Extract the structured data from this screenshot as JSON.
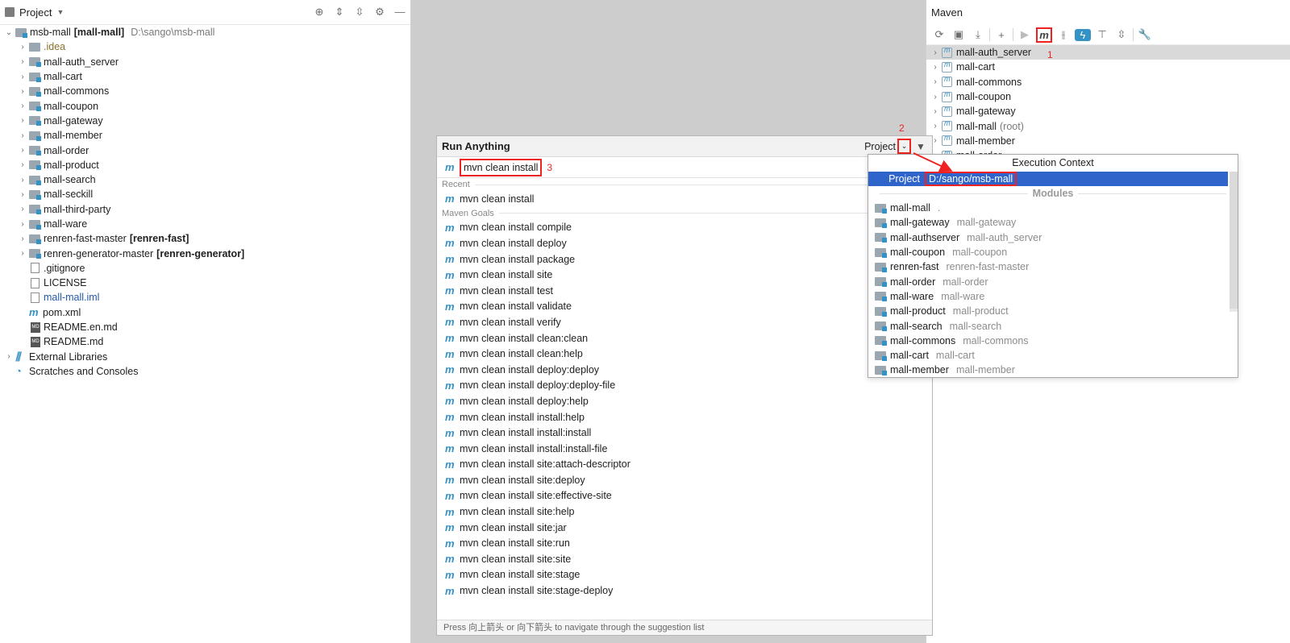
{
  "project": {
    "title": "Project",
    "tree": [
      {
        "label": "msb-mall",
        "bold": "[mall-mall]",
        "path": "D:\\sango\\msb-mall",
        "level": 0,
        "arrow": "v",
        "icon": "module-folder"
      },
      {
        "label": ".idea",
        "level": 1,
        "arrow": ">",
        "icon": "folder",
        "style": "brown"
      },
      {
        "label": "mall-auth_server",
        "level": 1,
        "arrow": ">",
        "icon": "module-folder",
        "style": "bold"
      },
      {
        "label": "mall-cart",
        "level": 1,
        "arrow": ">",
        "icon": "module-folder",
        "style": "bold"
      },
      {
        "label": "mall-commons",
        "level": 1,
        "arrow": ">",
        "icon": "module-folder",
        "style": "bold"
      },
      {
        "label": "mall-coupon",
        "level": 1,
        "arrow": ">",
        "icon": "module-folder",
        "style": "bold"
      },
      {
        "label": "mall-gateway",
        "level": 1,
        "arrow": ">",
        "icon": "module-folder",
        "style": "bold"
      },
      {
        "label": "mall-member",
        "level": 1,
        "arrow": ">",
        "icon": "module-folder",
        "style": "bold"
      },
      {
        "label": "mall-order",
        "level": 1,
        "arrow": ">",
        "icon": "module-folder",
        "style": "bold"
      },
      {
        "label": "mall-product",
        "level": 1,
        "arrow": ">",
        "icon": "module-folder",
        "style": "bold"
      },
      {
        "label": "mall-search",
        "level": 1,
        "arrow": ">",
        "icon": "module-folder",
        "style": "bold"
      },
      {
        "label": "mall-seckill",
        "level": 1,
        "arrow": ">",
        "icon": "module-folder",
        "style": "bold"
      },
      {
        "label": "mall-third-party",
        "level": 1,
        "arrow": ">",
        "icon": "module-folder",
        "style": "bold"
      },
      {
        "label": "mall-ware",
        "level": 1,
        "arrow": ">",
        "icon": "module-folder",
        "style": "bold"
      },
      {
        "label": "renren-fast-master",
        "bold": "[renren-fast]",
        "level": 1,
        "arrow": ">",
        "icon": "module-folder"
      },
      {
        "label": "renren-generator-master",
        "bold": "[renren-generator]",
        "level": 1,
        "arrow": ">",
        "icon": "module-folder"
      },
      {
        "label": ".gitignore",
        "level": 1,
        "arrow": "",
        "icon": "file"
      },
      {
        "label": "LICENSE",
        "level": 1,
        "arrow": "",
        "icon": "file"
      },
      {
        "label": "mall-mall.iml",
        "level": 1,
        "arrow": "",
        "icon": "file",
        "style": "blue"
      },
      {
        "label": "pom.xml",
        "level": 1,
        "arrow": "",
        "icon": "maven"
      },
      {
        "label": "README.en.md",
        "level": 1,
        "arrow": "",
        "icon": "md"
      },
      {
        "label": "README.md",
        "level": 1,
        "arrow": "",
        "icon": "md"
      },
      {
        "label": "External Libraries",
        "level": 0,
        "arrow": ">",
        "icon": "libraries"
      },
      {
        "label": "Scratches and Consoles",
        "level": 0,
        "arrow": "",
        "icon": "scratches"
      }
    ]
  },
  "maven": {
    "title": "Maven",
    "toolbar": [
      "refresh-icon",
      "folder-refresh-icon",
      "download-icon",
      "add-icon",
      "run-icon",
      "execute-maven-goal-icon",
      "toggle-offline-icon",
      "skip-tests-icon",
      "show-dependencies-icon",
      "collapse-all-icon",
      "settings-icon"
    ],
    "items": [
      {
        "label": "mall-auth_server",
        "suffix": ""
      },
      {
        "label": "mall-cart",
        "suffix": ""
      },
      {
        "label": "mall-commons",
        "suffix": ""
      },
      {
        "label": "mall-coupon",
        "suffix": ""
      },
      {
        "label": "mall-gateway",
        "suffix": ""
      },
      {
        "label": "mall-mall",
        "suffix": "(root)"
      },
      {
        "label": "mall-member",
        "suffix": ""
      },
      {
        "label": "mall-order",
        "suffix": ""
      }
    ]
  },
  "annotations": {
    "one": "1",
    "two": "2",
    "three": "3"
  },
  "run_anything": {
    "title": "Run Anything",
    "scope": "Project",
    "query": "mvn clean install",
    "recent_label": "Recent",
    "recent": [
      "mvn clean install"
    ],
    "goals_label": "Maven Goals",
    "goals": [
      "mvn clean install compile",
      "mvn clean install deploy",
      "mvn clean install package",
      "mvn clean install site",
      "mvn clean install test",
      "mvn clean install validate",
      "mvn clean install verify",
      "mvn clean install clean:clean",
      "mvn clean install clean:help",
      "mvn clean install deploy:deploy",
      "mvn clean install deploy:deploy-file",
      "mvn clean install deploy:help",
      "mvn clean install install:help",
      "mvn clean install install:install",
      "mvn clean install install:install-file",
      "mvn clean install site:attach-descriptor",
      "mvn clean install site:deploy",
      "mvn clean install site:effective-site",
      "mvn clean install site:help",
      "mvn clean install site:jar",
      "mvn clean install site:run",
      "mvn clean install site:site",
      "mvn clean install site:stage",
      "mvn clean install site:stage-deploy"
    ],
    "footer": "Press 向上箭头 or 向下箭头 to navigate through the suggestion list"
  },
  "execution_context": {
    "title": "Execution Context",
    "project_label": "Project",
    "project_path": "D:/sango/msb-mall",
    "modules_label": "Modules",
    "modules": [
      {
        "name": "mall-mall",
        "path": "."
      },
      {
        "name": "mall-gateway",
        "path": "mall-gateway"
      },
      {
        "name": "mall-authserver",
        "path": "mall-auth_server"
      },
      {
        "name": "mall-coupon",
        "path": "mall-coupon"
      },
      {
        "name": "renren-fast",
        "path": "renren-fast-master"
      },
      {
        "name": "mall-order",
        "path": "mall-order"
      },
      {
        "name": "mall-ware",
        "path": "mall-ware"
      },
      {
        "name": "mall-product",
        "path": "mall-product"
      },
      {
        "name": "mall-search",
        "path": "mall-search"
      },
      {
        "name": "mall-commons",
        "path": "mall-commons"
      },
      {
        "name": "mall-cart",
        "path": "mall-cart"
      },
      {
        "name": "mall-member",
        "path": "mall-member"
      }
    ]
  },
  "colors": {
    "selection": "#2f65ca",
    "annotation": "#e22222",
    "accent": "#3592c4"
  }
}
